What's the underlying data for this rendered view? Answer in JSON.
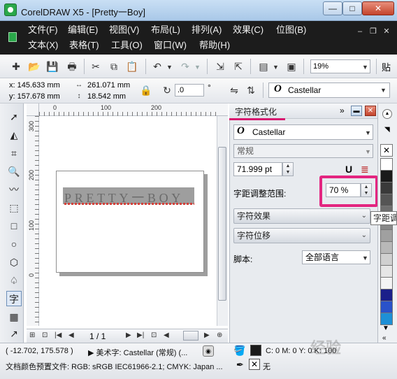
{
  "window": {
    "title": "CorelDRAW X5 - [Pretty一Boy]",
    "min": "—",
    "max": "□",
    "close": "✕"
  },
  "menu": {
    "row1": [
      "文件(F)",
      "编辑(E)",
      "视图(V)",
      "布局(L)",
      "排列(A)",
      "效果(C)",
      "位图(B)"
    ],
    "row2": [
      "文本(X)",
      "表格(T)",
      "工具(O)",
      "窗口(W)",
      "帮助(H)"
    ]
  },
  "toolbar1": {
    "zoom": "19%",
    "cut_label": "贴"
  },
  "toolbar2": {
    "x": "x: 145.633 mm",
    "y": "y: 157.678 mm",
    "width": "261.071 mm",
    "height": "18.542 mm",
    "rotation": ".0",
    "degree": "°",
    "font": "Castellar"
  },
  "ruler": {
    "h_ticks": [
      "0",
      "100",
      "200"
    ],
    "v_ticks": [
      "300",
      "200",
      "100",
      "0"
    ]
  },
  "canvas": {
    "artistic_text": "PRETTY一BOY"
  },
  "pagenav": {
    "page_label": "1 / 1"
  },
  "docker": {
    "title": "字符格式化",
    "font": "Castellar",
    "style": "常规",
    "size": "71.999 pt",
    "spacing_label": "字距调整范围:",
    "spacing_value": "70 %",
    "section_effects": "字符效果",
    "section_shift": "字符位移",
    "script_label": "脚本:",
    "script_value": "全部语言"
  },
  "tooltip": "字距调",
  "palette_colors": [
    "#ffffff",
    "#1a1a1a",
    "#3a3a3a",
    "#555555",
    "#6e6e6e",
    "#888888",
    "#a0a0a0",
    "#b8b8b8",
    "#d0d0d0",
    "#e6e6e6",
    "#f4f4f4",
    "#1b1f8a",
    "#2a52c9",
    "#1e90d6"
  ],
  "status": {
    "coords": "( -12.702, 175.578 )",
    "object_info": "▶ 美术字: Castellar (常规) (...",
    "fill_info": "C: 0 M: 0 Y: 0 K: 100",
    "profile": "文档颜色预置文件: RGB: sRGB IEC61966-2.1; CMYK: Japan ...",
    "outline": "无",
    "watermark": "经验"
  }
}
